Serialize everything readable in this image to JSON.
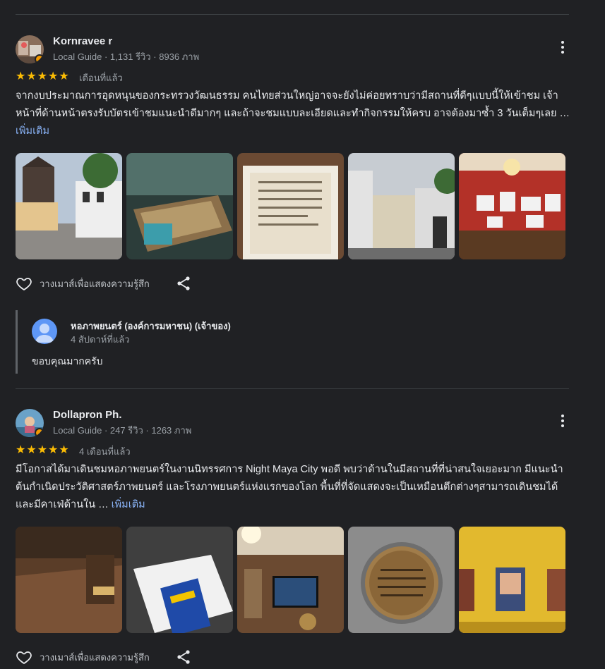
{
  "colors": {
    "background": "#202124",
    "accent_link": "#8ab4f8",
    "star": "#fbbc04",
    "secondary_text": "#9aa0a6"
  },
  "reviews": [
    {
      "name": "Kornravee r",
      "meta": "Local Guide · 1,131 รีวิว · 8936 ภาพ",
      "stars": "★★★★★",
      "rating": 5,
      "when": "เดือนที่แล้ว",
      "body": "จากงบประมาณการอุดหนุนของกระทรวงวัฒนธรรม คนไทยส่วนใหญ่อาจจะยังไม่ค่อยทราบว่ามีสถานที่ดีๆแบบนี้ให้เข้าชม เจ้าหน้าที่ด้านหน้าตรงรับบัตรเข้าชมแนะนำดีมากๆ และถ้าจะชมแบบละเอียดและทำกิจกรรมให้ครบ อาจต้องมาซ้ำ 3 วันเต็มๆเลย …",
      "more": "เพิ่มเติม",
      "like_label": "วางเมาส์เพื่อแสดงความรู้สึก",
      "icons": {
        "like": "heart-icon",
        "share": "share-icon",
        "menu": "more-vert-icon"
      }
    },
    {
      "name": "Dollapron Ph.",
      "meta": "Local Guide · 247 รีวิว · 1263 ภาพ",
      "stars": "★★★★★",
      "rating": 5,
      "when": "4 เดือนที่แล้ว",
      "body": "มีโอกาสได้มาเดินชมหอภาพยนตร์ในงานนิทรรศการ Night Maya City พอดี พบว่าด้านในมีสถานที่ที่น่าสนใจเยอะมาก มีแนะนำต้นกำเนิดประวัติศาสตร์ภาพยนตร์ และโรงภาพยนตร์แห่งแรกของโลก พื้นที่ที่จัดแสดงจะเป็นเหมือนตึกต่างๆสามารถเดินชมได้และมีคาเฟ่ด้านใน …",
      "more": "เพิ่มเติม",
      "like_label": "วางเมาส์เพื่อแสดงความรู้สึก",
      "icons": {
        "like": "heart-icon",
        "share": "share-icon",
        "menu": "more-vert-icon"
      }
    }
  ],
  "owner_reply": {
    "name": "หอภาพยนตร์ (องค์การมหาชน) (เจ้าของ)",
    "when": "4 สัปดาห์ที่แล้ว",
    "text": "ขอบคุณมากครับ"
  }
}
